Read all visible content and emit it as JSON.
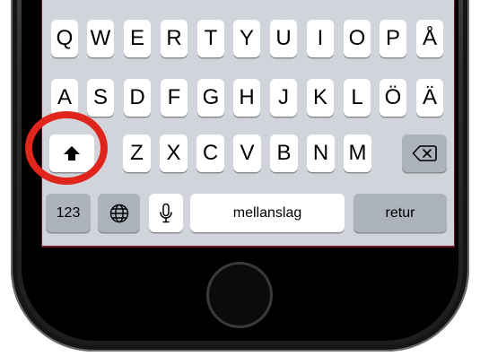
{
  "keyboard": {
    "row1": [
      "Q",
      "W",
      "E",
      "R",
      "T",
      "Y",
      "U",
      "I",
      "O",
      "P",
      "Å"
    ],
    "row2": [
      "A",
      "S",
      "D",
      "F",
      "G",
      "H",
      "J",
      "K",
      "L",
      "Ö",
      "Ä"
    ],
    "row3": [
      "Z",
      "X",
      "C",
      "V",
      "B",
      "N",
      "M"
    ],
    "numbers_label": "123",
    "space_label": "mellanslag",
    "return_label": "retur"
  },
  "icons": {
    "shift": "shift-arrow-up-icon",
    "backspace": "backspace-icon",
    "globe": "globe-icon",
    "microphone": "microphone-icon"
  },
  "colors": {
    "keyboard_bg": "#d1d4da",
    "key_light": "#ffffff",
    "key_dark": "#adb3bc",
    "highlight": "#e0251c"
  }
}
